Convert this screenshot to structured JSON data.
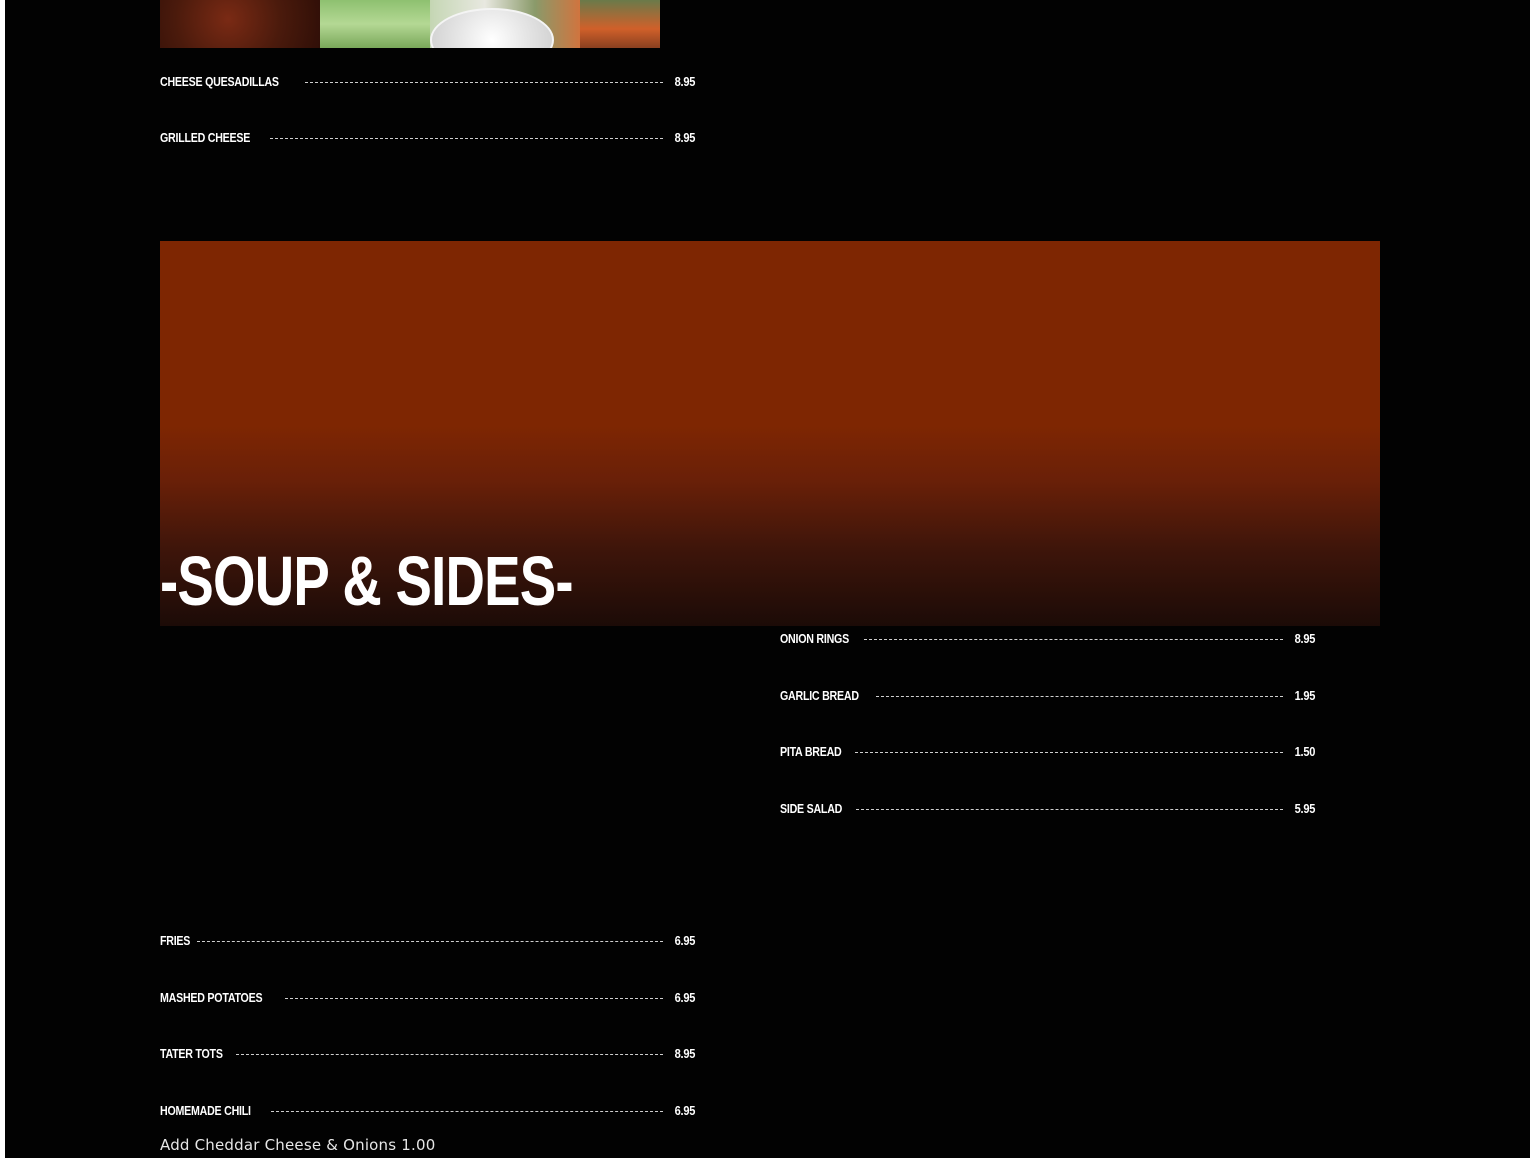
{
  "top_section": {
    "photo_alt": "",
    "items": [
      {
        "name": "CHEESE QUESADILLAS",
        "price": "8.95"
      },
      {
        "name": "GRILLED CHEESE",
        "price": "8.95"
      }
    ]
  },
  "soup_sides": {
    "title": "-SOUP & SIDES-",
    "banner_color": "#7E2602",
    "right_items": [
      {
        "name": "ONION RINGS",
        "price": "8.95"
      },
      {
        "name": "GARLIC BREAD",
        "price": "1.95"
      },
      {
        "name": "PITA BREAD",
        "price": "1.50"
      },
      {
        "name": "SIDE SALAD",
        "price": "5.95"
      }
    ],
    "left_items": [
      {
        "name": "FRIES",
        "price": "6.95"
      },
      {
        "name": "MASHED POTATOES",
        "price": "6.95"
      },
      {
        "name": "TATER TOTS",
        "price": "8.95"
      },
      {
        "name": "HOMEMADE CHILI",
        "price": "6.95"
      }
    ],
    "note": "Add Cheddar Cheese & Onions 1.00"
  }
}
